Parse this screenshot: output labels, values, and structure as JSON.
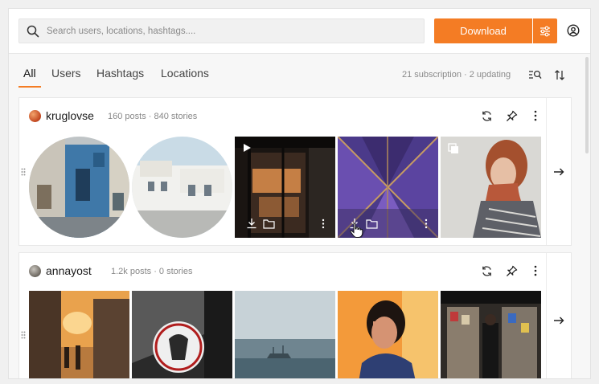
{
  "search": {
    "placeholder": "Search users, locations, hashtags...."
  },
  "toolbar": {
    "download_label": "Download"
  },
  "tabs": [
    {
      "label": "All",
      "active": true
    },
    {
      "label": "Users"
    },
    {
      "label": "Hashtags"
    },
    {
      "label": "Locations"
    }
  ],
  "subscription_info": "21 subscription · 2 updating",
  "accent_color": "#f47c24",
  "subscriptions": [
    {
      "username": "kruglovse",
      "stats": "160 posts · 840 stories",
      "items": [
        {
          "kind": "story",
          "shape": "circle"
        },
        {
          "kind": "story",
          "shape": "circle"
        },
        {
          "kind": "video",
          "overlay": "play-icon"
        },
        {
          "kind": "photo",
          "hovered": true
        },
        {
          "kind": "carousel",
          "overlay": "gallery-icon"
        }
      ]
    },
    {
      "username": "annayost",
      "stats": "1.2k posts · 0 stories",
      "items": [
        {
          "kind": "photo"
        },
        {
          "kind": "photo"
        },
        {
          "kind": "photo"
        },
        {
          "kind": "photo"
        },
        {
          "kind": "photo"
        }
      ]
    }
  ]
}
